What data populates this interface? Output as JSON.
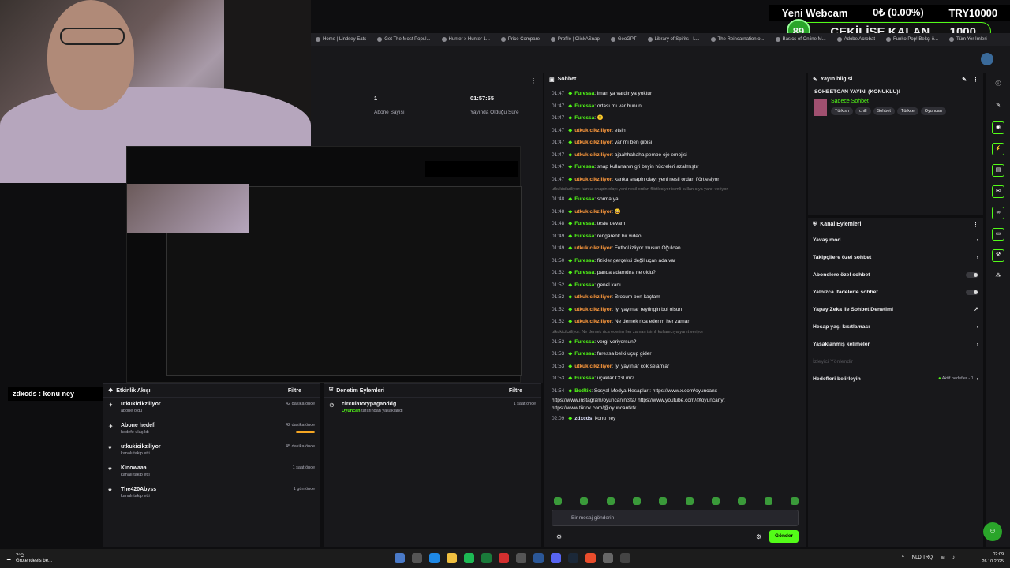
{
  "bookmarks": [
    "Home | Lindsey Eats",
    "Get The Most Popul...",
    "Hunter x Hunter 1...",
    "Price Compare",
    "Profile | ClickASnap",
    "GeoGPT",
    "Library of Spirits - L...",
    "The Reincarnation o...",
    "Basics of Online M...",
    "Adobe Acrobat",
    "Funko Pop! Bekçi ö...",
    "Tüm Yer İmleri"
  ],
  "overlay": {
    "webcam_label": "Yeni Webcam",
    "percent": "0₺ (0.00%)",
    "goal": "TRY10000",
    "badge": "89",
    "giveaway": "ÇEKİLİŞE KALAN",
    "giveaway_num": "1000"
  },
  "stats": {
    "subs_value": "1",
    "subs_label": "Abone Sayısı",
    "uptime_value": "01:57:55",
    "uptime_label": "Yayında Olduğu Süre"
  },
  "streamer_tag": "zdxcds : konu ney",
  "activity": {
    "title": "Etkinlik Akışı",
    "filter": "Filtre",
    "items": [
      {
        "icon": "star-icon",
        "name": "utkukicikziliyor",
        "sub": "abone oldu",
        "time": "42 dakika önce",
        "bar": false
      },
      {
        "icon": "star-icon",
        "name": "Abone hedefi",
        "sub": "hedefe ulaşıldı",
        "time": "42 dakika önce",
        "bar": true
      },
      {
        "icon": "heart-icon",
        "name": "utkukicikziliyor",
        "sub": "kanalı takip etti",
        "time": "45 dakika önce",
        "bar": false
      },
      {
        "icon": "heart-icon",
        "name": "Kinowaaa",
        "sub": "kanalı takip etti",
        "time": "1 saat önce",
        "bar": false
      },
      {
        "icon": "heart-icon",
        "name": "The420Abyss",
        "sub": "kanalı takip etti",
        "time": "1 gün önce",
        "bar": false
      }
    ]
  },
  "moderation": {
    "title": "Denetim Eylemleri",
    "filter": "Filtre",
    "item_name": "circulatorypaganddg",
    "item_actor": "Oyuncan",
    "item_sub": "tarafından yasaklandı",
    "item_time": "1 saat önce"
  },
  "chat": {
    "title": "Sohbet",
    "input_placeholder": "Bir mesaj gönderin",
    "send": "Gönder",
    "lines": [
      {
        "ts": "01:47",
        "user": "Furessa",
        "cls": "u1",
        "msg": ": iman ya vardır ya yoktur"
      },
      {
        "ts": "01:47",
        "user": "Furessa",
        "cls": "u1",
        "msg": ": ortası mı var bunun"
      },
      {
        "ts": "01:47",
        "user": "Furessa",
        "cls": "u1",
        "msg": ": 🙂"
      },
      {
        "ts": "01:47",
        "user": "utkukicikziliyor",
        "cls": "u2",
        "msg": ": etsin"
      },
      {
        "ts": "01:47",
        "user": "utkukicikziliyor",
        "cls": "u2",
        "msg": ": var mı ben gibisi"
      },
      {
        "ts": "01:47",
        "user": "utkukicikziliyor",
        "cls": "u2",
        "msg": ": ajaahhahaha pembe oje emojisi"
      },
      {
        "ts": "01:47",
        "user": "Furessa",
        "cls": "u1",
        "msg": ": snap kullananın gri beyin hücreleri azalmıştır"
      },
      {
        "ts": "01:47",
        "user": "utkukicikziliyor",
        "cls": "u2",
        "msg": ": kanka snapin olayı yeni nesil ordan flörtlesiyor"
      },
      {
        "ts": "",
        "user": "",
        "cls": "reply",
        "msg": "utkukicikziliyor: kanka snapin olayı yeni nesil ordan flörtlesiyor isimli kullanıcıya yanıt veriyor"
      },
      {
        "ts": "01:48",
        "user": "Furessa",
        "cls": "u1",
        "msg": ": sorma ya"
      },
      {
        "ts": "01:48",
        "user": "utkukicikziliyor",
        "cls": "u2",
        "msg": ": 😄"
      },
      {
        "ts": "01:48",
        "user": "Furessa",
        "cls": "u1",
        "msg": ": teste devam"
      },
      {
        "ts": "01:49",
        "user": "Furessa",
        "cls": "u1",
        "msg": ": rengarenk bir video"
      },
      {
        "ts": "01:49",
        "user": "utkukicikziliyor",
        "cls": "u2",
        "msg": ": Futbol izliyor musun Oğulcan"
      },
      {
        "ts": "01:50",
        "user": "Furessa",
        "cls": "u1",
        "msg": ": fizikler gerçekçi değil uçan ada var"
      },
      {
        "ts": "01:52",
        "user": "Furessa",
        "cls": "u1",
        "msg": ": panda adamdıra ne oldu?"
      },
      {
        "ts": "01:52",
        "user": "Furessa",
        "cls": "u1",
        "msg": ": genel kanı"
      },
      {
        "ts": "01:52",
        "user": "utkukicikziliyor",
        "cls": "u2",
        "msg": ": Brocum ben kaçtam"
      },
      {
        "ts": "01:52",
        "user": "utkukicikziliyor",
        "cls": "u2",
        "msg": ": İyi yayınlar reytingin bol olsun"
      },
      {
        "ts": "01:52",
        "user": "utkukicikziliyor",
        "cls": "u2",
        "msg": ": Ne demek rica ederim her zaman"
      },
      {
        "ts": "",
        "user": "",
        "cls": "reply",
        "msg": "utkukicikziliyor: Ne demek rica ederim her zaman isimli kullanıcıya yanıt veriyor"
      },
      {
        "ts": "01:52",
        "user": "Furessa",
        "cls": "u1",
        "msg": ": vergi veriyorsun?"
      },
      {
        "ts": "01:53",
        "user": "Furessa",
        "cls": "u1",
        "msg": ": furessa belki uçup gider"
      },
      {
        "ts": "01:53",
        "user": "utkukicikziliyor",
        "cls": "u2",
        "msg": ": İyi yayınlar çok selamlar"
      },
      {
        "ts": "01:53",
        "user": "Furessa",
        "cls": "u1",
        "msg": ": uçaklar CGI mı?"
      },
      {
        "ts": "01:54",
        "user": "BotRix",
        "cls": "u3",
        "msg": ": Sosyal Medya Hesapları: https://www.x.com/oyuncanx"
      },
      {
        "ts": "",
        "user": "",
        "cls": "plain",
        "msg": "https://www.instagram/oyuncanintsta/ https://www.youtube.com/@oyuncanyt"
      },
      {
        "ts": "",
        "user": "",
        "cls": "plain",
        "msg": "https://www.tiktok.com/@oyuncantktk"
      },
      {
        "ts": "02:09",
        "user": "zdxcds",
        "cls": "u4",
        "msg": ": konu ney"
      }
    ]
  },
  "stream_info": {
    "title": "Yayın bilgisi",
    "heading": "SOHBETCAN YAYINI (KONUKLU)!",
    "category": "Sadece Sohbet",
    "tags": [
      "Türkish",
      "chill",
      "Sohbet",
      "Türkçe",
      "Oyuncan"
    ]
  },
  "channel_actions": {
    "title": "Kanal Eylemleri",
    "rows": [
      {
        "label": "Yavaş mod",
        "type": "arrow"
      },
      {
        "label": "Takipçilere özel sohbet",
        "type": "arrow"
      },
      {
        "label": "Abonelere özel sohbet",
        "type": "toggle"
      },
      {
        "label": "Yalnızca ifadelerle sohbet",
        "type": "toggle"
      },
      {
        "label": "Yapay Zeka ile Sohbet Denetimi",
        "type": "ext"
      },
      {
        "label": "Hesap yaşı kısıtlaması",
        "type": "arrow"
      },
      {
        "label": "Yasaklanmış kelimeler",
        "type": "arrow"
      },
      {
        "label": "İzleyici Yönlendir",
        "type": "disabled"
      },
      {
        "label": "Hedefleri belirleyin",
        "type": "goal",
        "extra": "Aktif hedefler - 1"
      }
    ]
  },
  "taskbar": {
    "temp": "7°C",
    "location": "Grotendeels be...",
    "lang": "NLD TRQ",
    "time": "02:09",
    "date": "26.10.2025"
  },
  "colors": {
    "accent": "#53fc18",
    "bg": "#18181b"
  }
}
